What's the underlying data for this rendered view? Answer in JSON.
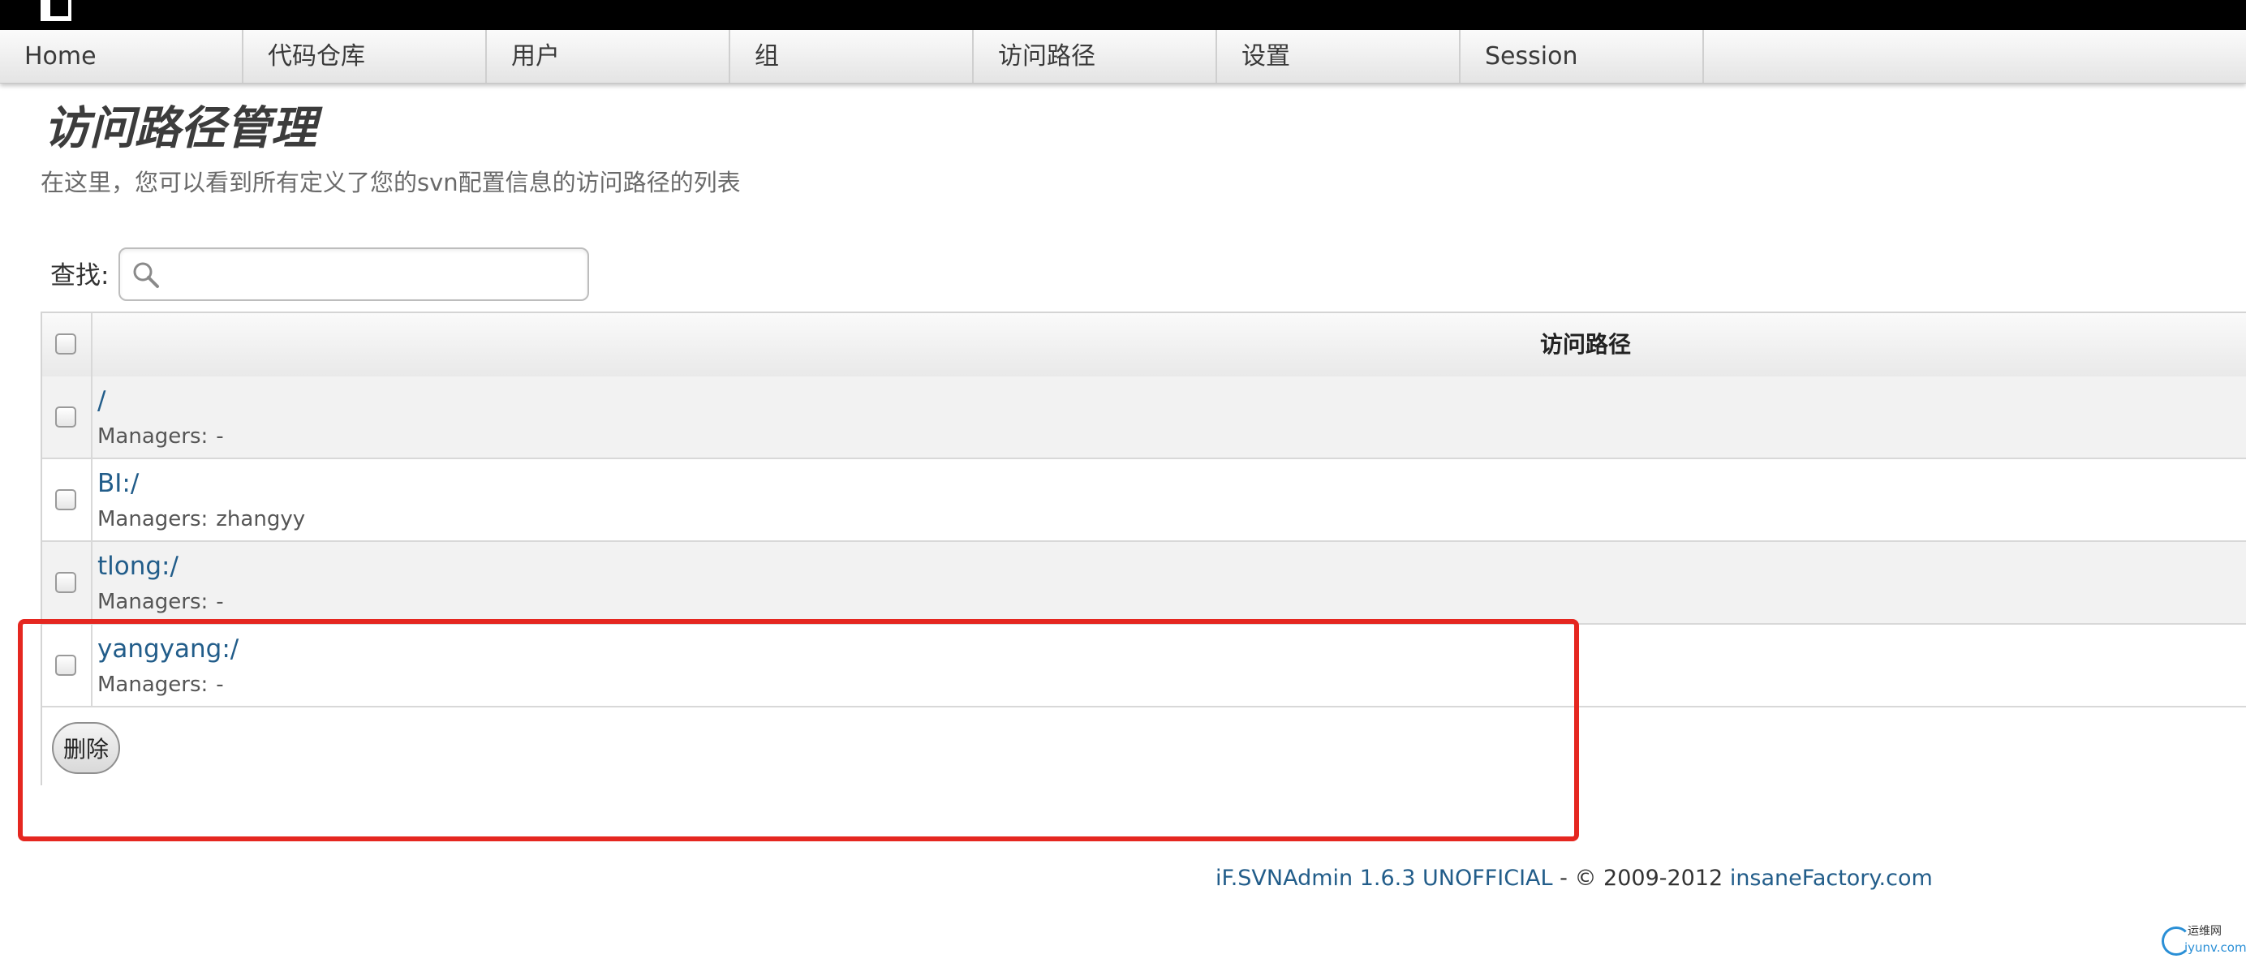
{
  "nav": {
    "items": [
      {
        "label": "Home"
      },
      {
        "label": "代码仓库"
      },
      {
        "label": "用户"
      },
      {
        "label": "组"
      },
      {
        "label": "访问路径"
      },
      {
        "label": "设置"
      },
      {
        "label": "Session"
      }
    ]
  },
  "page": {
    "title": "访问路径管理",
    "description": "在这里，您可以看到所有定义了您的svn配置信息的访问路径的列表"
  },
  "search": {
    "label": "查找:",
    "value": "",
    "placeholder": "",
    "icon": "magnifier-icon"
  },
  "table": {
    "header": {
      "column": "访问路径"
    },
    "rows": [
      {
        "path": "/",
        "managers_label": "Managers:",
        "managers": "-",
        "checked": false
      },
      {
        "path": "BI:/",
        "managers_label": "Managers:",
        "managers": "zhangyy",
        "checked": false
      },
      {
        "path": "tlong:/",
        "managers_label": "Managers:",
        "managers": "-",
        "checked": false
      },
      {
        "path": "yangyang:/",
        "managers_label": "Managers:",
        "managers": "-",
        "checked": false
      }
    ],
    "delete_label": "删除"
  },
  "footer": {
    "product": "iF.SVNAdmin 1.6.3 UNOFFICIAL",
    "separator": " - © 2009-2012 ",
    "company": "insaneFactory.com"
  },
  "watermark": {
    "line1": "运维网",
    "line2": "iyunv.com"
  },
  "colors": {
    "link": "#225d8a",
    "highlight": "#e52720",
    "topbar": "#000000"
  }
}
